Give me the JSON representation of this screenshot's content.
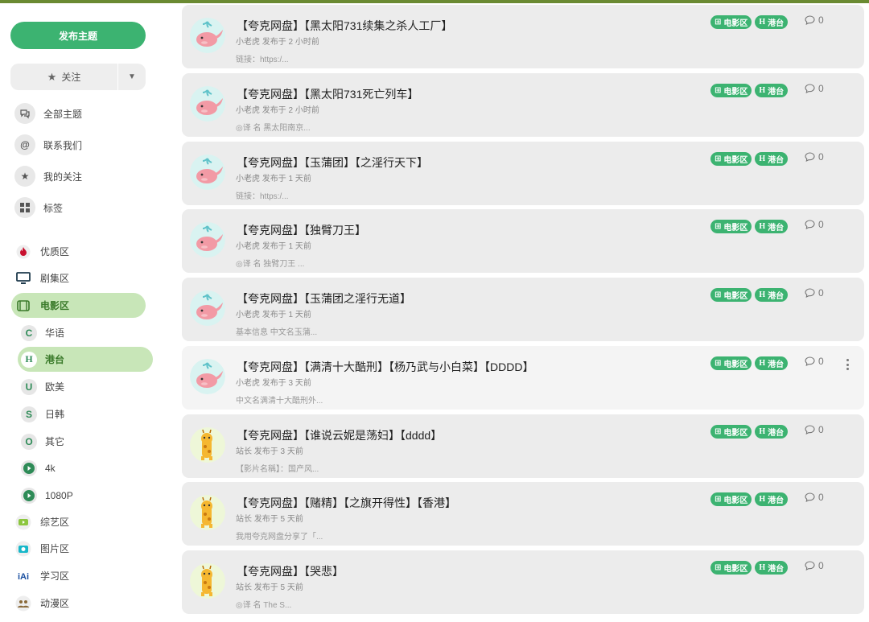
{
  "sidebar": {
    "new_topic": "发布主题",
    "follow": "关注",
    "nav": [
      {
        "label": "全部主题",
        "icon": "chat-bubbles-icon"
      },
      {
        "label": "联系我们",
        "icon": "at-sign-icon"
      },
      {
        "label": "我的关注",
        "icon": "star-icon"
      },
      {
        "label": "标签",
        "icon": "grid-icon"
      }
    ],
    "categories": [
      {
        "label": "优质区",
        "icon": "flame-icon"
      },
      {
        "label": "剧集区",
        "icon": "monitor-icon"
      },
      {
        "label": "电影区",
        "icon": "film-icon"
      },
      {
        "label": "华语",
        "icon": "c-letter-icon",
        "glyph": "C"
      },
      {
        "label": "港台",
        "icon": "h-letter-icon",
        "glyph": "H"
      },
      {
        "label": "欧美",
        "icon": "u-letter-icon",
        "glyph": "U"
      },
      {
        "label": "日韩",
        "icon": "s-letter-icon",
        "glyph": "S"
      },
      {
        "label": "其它",
        "icon": "o-letter-icon",
        "glyph": "O"
      },
      {
        "label": "4k",
        "icon": "play-circle-icon"
      },
      {
        "label": "1080P",
        "icon": "play-circle-icon"
      },
      {
        "label": "综艺区",
        "icon": "tv-play-icon"
      },
      {
        "label": "图片区",
        "icon": "camera-icon"
      },
      {
        "label": "学习区",
        "icon": "classroom-icon"
      },
      {
        "label": "动漫区",
        "icon": "users-icon"
      }
    ]
  },
  "tags": {
    "movie": "电影区",
    "hk": "港台"
  },
  "topics": [
    {
      "title": "【夸克网盘】【黑太阳731续集之杀人工厂】",
      "author": "小老虎",
      "time": "发布于 2 小时前",
      "excerpt": "链接：https:/...",
      "replies": "0",
      "avatar": "whale"
    },
    {
      "title": "【夸克网盘】【黑太阳731死亡列车】",
      "author": "小老虎",
      "time": "发布于 2 小时前",
      "excerpt": "◎译 名 黑太阳南京...",
      "replies": "0",
      "avatar": "whale"
    },
    {
      "title": "【夸克网盘】【玉蒲团】【之淫行天下】",
      "author": "小老虎",
      "time": "发布于 1 天前",
      "excerpt": "链接：https:/...",
      "replies": "0",
      "avatar": "whale"
    },
    {
      "title": "【夸克网盘】【独臂刀王】",
      "author": "小老虎",
      "time": "发布于 1 天前",
      "excerpt": "◎译 名 独臂刀王 ...",
      "replies": "0",
      "avatar": "whale"
    },
    {
      "title": "【夸克网盘】【玉蒲团之淫行无道】",
      "author": "小老虎",
      "time": "发布于 1 天前",
      "excerpt": "基本信息 中文名玉蒲...",
      "replies": "0",
      "avatar": "whale"
    },
    {
      "title": "【夸克网盘】【满清十大酷刑】【杨乃武与小白菜】【DDDD】",
      "author": "小老虎",
      "time": "发布于 3 天前",
      "excerpt": "中文名满清十大酷刑外...",
      "replies": "0",
      "avatar": "whale"
    },
    {
      "title": "【夸克网盘】【谁说云妮是荡妇】【dddd】",
      "author": "站长",
      "time": "发布于 3 天前",
      "excerpt": "【影片名稱】：国产风...",
      "replies": "0",
      "avatar": "giraffe"
    },
    {
      "title": "【夸克网盘】【赌精】【之旗开得性】【香港】",
      "author": "站长",
      "time": "发布于 5 天前",
      "excerpt": "我用夸克网盘分享了「...",
      "replies": "0",
      "avatar": "giraffe"
    },
    {
      "title": "【夸克网盘】【哭悲】",
      "author": "站长",
      "time": "发布于 5 天前",
      "excerpt": "◎译 名 The S...",
      "replies": "0",
      "avatar": "giraffe"
    }
  ]
}
